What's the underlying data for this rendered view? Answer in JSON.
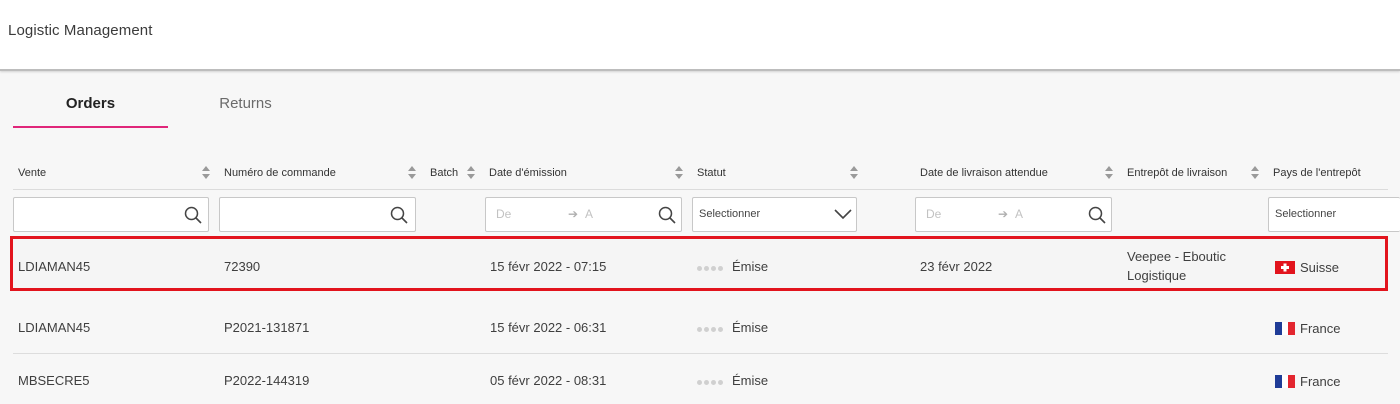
{
  "app": {
    "title": "Logistic Management"
  },
  "tabs": [
    {
      "label": "Orders",
      "active": true
    },
    {
      "label": "Returns",
      "active": false
    }
  ],
  "columns": {
    "vente": "Vente",
    "numero": "Numéro de commande",
    "batch": "Batch",
    "date_emission": "Date d'émission",
    "statut": "Statut",
    "date_livraison": "Date de livraison attendue",
    "entrepot": "Entrepôt de livraison",
    "pays": "Pays de l'entrepôt"
  },
  "filters": {
    "date_from": "De",
    "date_arrow": "➔",
    "date_to": "A",
    "select_placeholder": "Selectionner"
  },
  "rows": [
    {
      "vente": "LDIAMAN45",
      "numero": "72390",
      "date_emission": "15 févr 2022 - 07:15",
      "statut": "Émise",
      "date_livraison": "23 févr 2022",
      "entrepot_line1": "Veepee - Eboutic",
      "entrepot_line2": "Logistique",
      "pays": "Suisse",
      "flag": "switzerland-flag-icon",
      "highlighted": true
    },
    {
      "vente": "LDIAMAN45",
      "numero": "P2021-131871",
      "date_emission": "15 févr 2022 - 06:31",
      "statut": "Émise",
      "date_livraison": "",
      "entrepot_line1": "",
      "entrepot_line2": "",
      "pays": "France",
      "flag": "france-flag-icon",
      "highlighted": false
    },
    {
      "vente": "MBSECRE5",
      "numero": "P2022-144319",
      "date_emission": "05 févr 2022 - 08:31",
      "statut": "Émise",
      "date_livraison": "",
      "entrepot_line1": "",
      "entrepot_line2": "",
      "pays": "France",
      "flag": "france-flag-icon",
      "highlighted": false
    }
  ],
  "colors": {
    "accent": "#e0267a",
    "highlight_border": "#e2141d",
    "ch_red": "#e2141d",
    "fr_blue": "#1f3c97",
    "fr_red": "#e3262f"
  }
}
